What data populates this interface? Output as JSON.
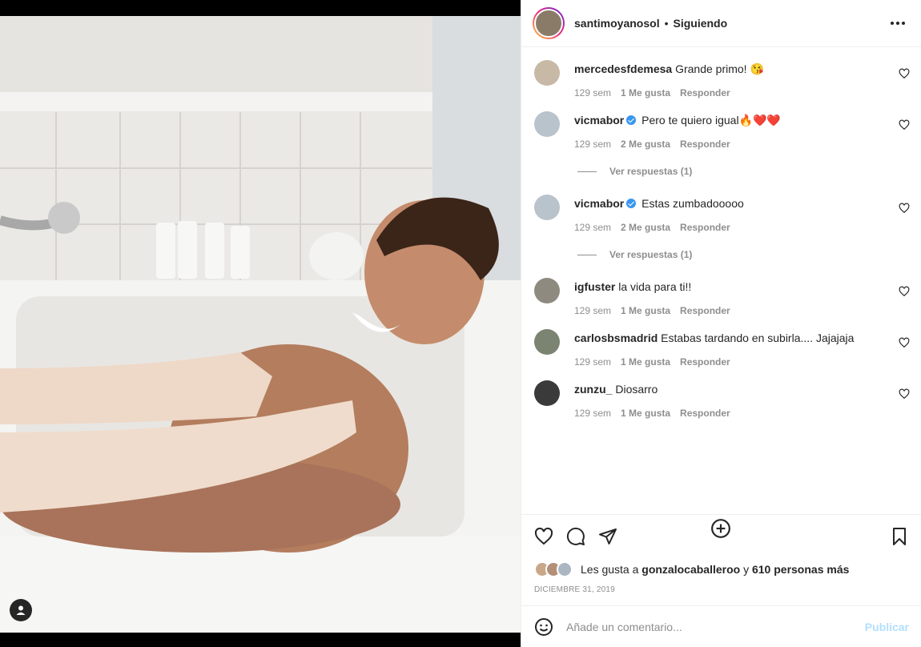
{
  "post": {
    "username": "santimoyanosol",
    "separator": "•",
    "follow_status": "Siguiendo",
    "more_icon": "ellipsis-icon"
  },
  "comments": [
    {
      "user": "mercedesfdemesa",
      "verified": false,
      "text": "Grande primo! 😘",
      "time": "129 sem",
      "likes": "1 Me gusta",
      "reply": "Responder",
      "replies_link": null,
      "avatar_color": "#c8b8a6"
    },
    {
      "user": "vicmabor",
      "verified": true,
      "text": "Pero te quiero igual🔥❤️❤️",
      "time": "129 sem",
      "likes": "2 Me gusta",
      "reply": "Responder",
      "replies_link": "Ver respuestas (1)",
      "avatar_color": "#b9c3cc"
    },
    {
      "user": "vicmabor",
      "verified": true,
      "text": "Estas zumbadooooo",
      "time": "129 sem",
      "likes": "2 Me gusta",
      "reply": "Responder",
      "replies_link": "Ver respuestas (1)",
      "avatar_color": "#b9c3cc"
    },
    {
      "user": "igfuster",
      "verified": false,
      "text": "la vida para ti!!",
      "time": "129 sem",
      "likes": "1 Me gusta",
      "reply": "Responder",
      "replies_link": null,
      "avatar_color": "#8f8a80"
    },
    {
      "user": "carlosbsmadrid",
      "verified": false,
      "text": "Estabas tardando en subirla.... Jajajaja",
      "time": "129 sem",
      "likes": "1 Me gusta",
      "reply": "Responder",
      "replies_link": null,
      "avatar_color": "#7a8470"
    },
    {
      "user": "zunzu_",
      "verified": false,
      "text": "Diosarro",
      "time": "129 sem",
      "likes": "1 Me gusta",
      "reply": "Responder",
      "replies_link": null,
      "avatar_color": "#3a3a3a"
    }
  ],
  "likes_summary": {
    "prefix": "Les gusta a",
    "user": "gonzalocaballeroo",
    "joiner": "y",
    "others": "610 personas más"
  },
  "date": "DICIEMBRE 31, 2019",
  "comment_box": {
    "placeholder": "Añade un comentario...",
    "publish_label": "Publicar"
  },
  "colors": {
    "text": "#262626",
    "secondary": "#8e8e8e",
    "verified": "#3897f0",
    "publish_disabled": "#b2dffc"
  }
}
